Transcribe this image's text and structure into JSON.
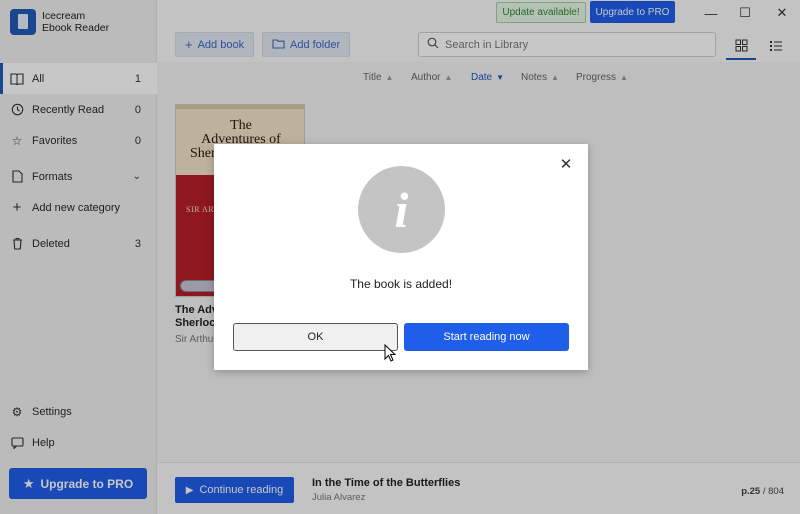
{
  "app": {
    "name_line1": "Icecream",
    "name_line2": "Ebook Reader"
  },
  "sidebar": {
    "items": [
      {
        "label": "All",
        "count": "1",
        "icon": "book-open-icon"
      },
      {
        "label": "Recently Read",
        "count": "0",
        "icon": "history-icon"
      },
      {
        "label": "Favorites",
        "count": "0",
        "icon": "star-outline-icon"
      },
      {
        "label": "Formats",
        "count": "",
        "icon": "file-icon"
      },
      {
        "label": "Add new category",
        "count": "",
        "icon": "plus-icon"
      },
      {
        "label": "Deleted",
        "count": "3",
        "icon": "trash-icon"
      }
    ],
    "settings_label": "Settings",
    "help_label": "Help",
    "upgrade_label": "Upgrade to PRO"
  },
  "topbar": {
    "update_label": "Update available!",
    "upgrade_label": "Upgrade to PRO",
    "add_book_label": "Add book",
    "add_folder_label": "Add folder",
    "search_placeholder": "Search in Library"
  },
  "sort": {
    "title": "Title",
    "author": "Author",
    "date": "Date",
    "notes": "Notes",
    "progress": "Progress",
    "active": "Date"
  },
  "book": {
    "cover_title_1": "The",
    "cover_title_2": "Adventures of",
    "cover_title_3": "Sherl",
    "cover_author": "SIR ART",
    "name_line1": "The Adv",
    "name_line2": "Sherlock",
    "author": "Sir Arthur"
  },
  "modal": {
    "message": "The book is added!",
    "ok_label": "OK",
    "start_label": "Start reading now",
    "icon": "info-icon"
  },
  "bottombar": {
    "continue_label": "Continue reading",
    "current_title": "In the Time of the Butterflies",
    "current_author": "Julia Alvarez",
    "page_prefix": "p.",
    "page_current": "25",
    "page_total": "/ 804"
  },
  "colors": {
    "accent": "#1f5ee9",
    "update_green": "#2a8a30"
  }
}
